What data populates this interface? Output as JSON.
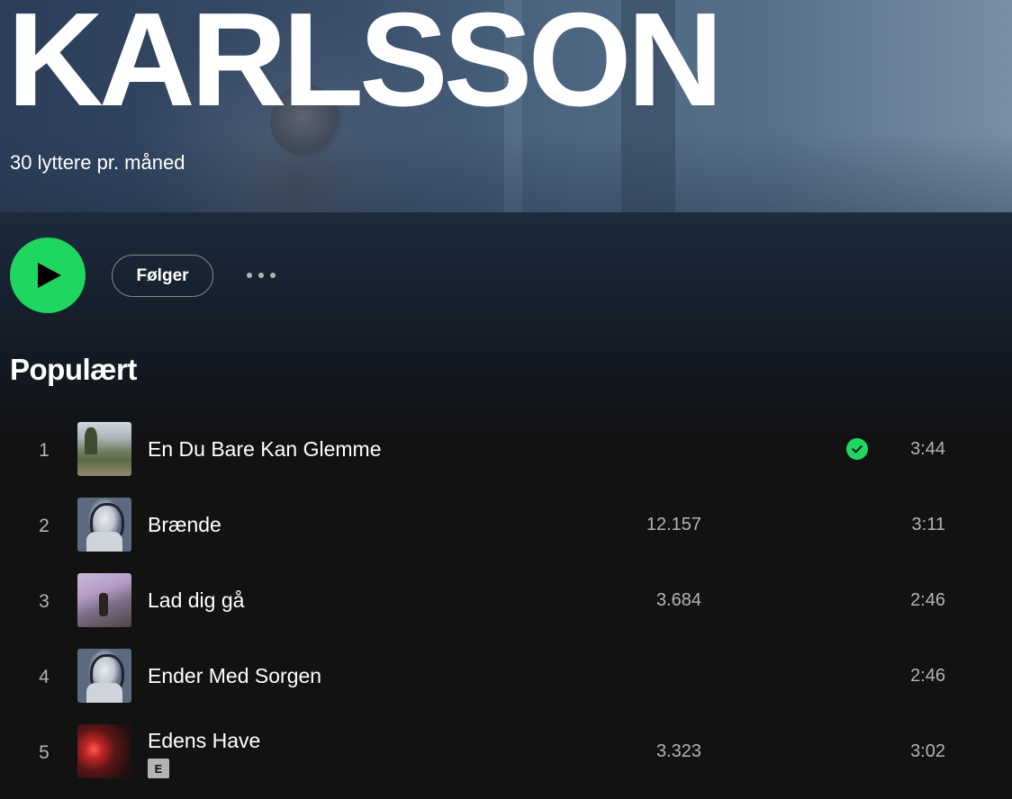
{
  "artist": {
    "name": "KARLSSON",
    "monthly_listeners": "30 lyttere pr. måned"
  },
  "actions": {
    "follow_label": "Følger"
  },
  "popular": {
    "title": "Populært",
    "tracks": [
      {
        "number": "1",
        "title": "En Du Bare Kan Glemme",
        "plays": "",
        "duration": "3:44",
        "saved": true,
        "explicit": false
      },
      {
        "number": "2",
        "title": "Brænde",
        "plays": "12.157",
        "duration": "3:11",
        "saved": false,
        "explicit": false
      },
      {
        "number": "3",
        "title": "Lad dig gå",
        "plays": "3.684",
        "duration": "2:46",
        "saved": false,
        "explicit": false
      },
      {
        "number": "4",
        "title": "Ender Med Sorgen",
        "plays": "",
        "duration": "2:46",
        "saved": false,
        "explicit": false
      },
      {
        "number": "5",
        "title": "Edens Have",
        "plays": "3.323",
        "duration": "3:02",
        "saved": false,
        "explicit": true,
        "explicit_label": "E"
      }
    ]
  },
  "colors": {
    "accent": "#1ed760",
    "background": "#121212",
    "secondary_text": "#b3b3b3"
  },
  "icons": {
    "play": "play-icon",
    "more": "more-options-icon",
    "saved": "check-circle-icon"
  }
}
